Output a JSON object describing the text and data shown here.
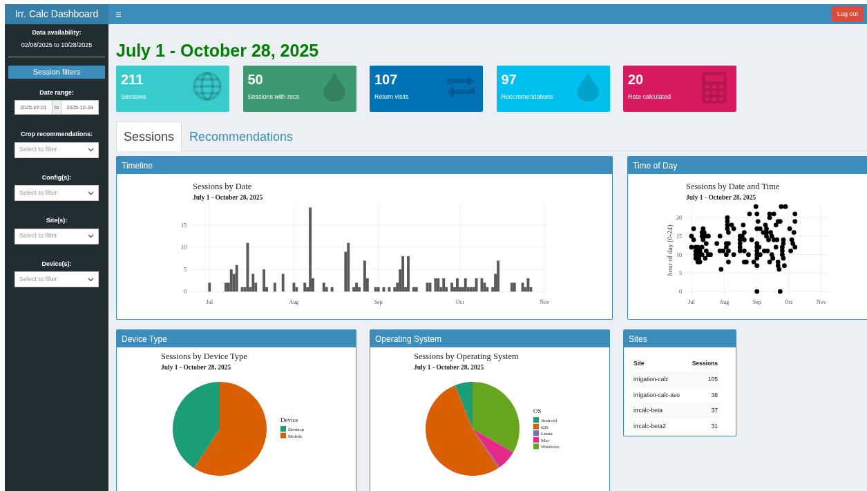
{
  "header": {
    "title": "Irr. Calc Dashboard",
    "menu_icon": "≡",
    "logout": "Log out"
  },
  "sidebar": {
    "availability_label": "Data availability:",
    "availability_range": "02/08/2025 to 10/28/2025",
    "filters_title": "Session filters",
    "date_range": {
      "label": "Date range:",
      "start": "2025-07-01",
      "separator": "to",
      "end": "2025-10-28"
    },
    "filters": [
      {
        "label": "Crop recommendations:",
        "placeholder": "Select to filter"
      },
      {
        "label": "Config(s):",
        "placeholder": "Select to filter"
      },
      {
        "label": "Site(s):",
        "placeholder": "Select to filter"
      },
      {
        "label": "Device(s):",
        "placeholder": "Select to filter"
      }
    ]
  },
  "page_title": "July 1 - October 28, 2025",
  "value_boxes": [
    {
      "value": "211",
      "label": "Sessions",
      "color": "#39cccc"
    },
    {
      "value": "50",
      "label": "Sessions with recs",
      "color": "#3d9970"
    },
    {
      "value": "107",
      "label": "Return visits",
      "color": "#0073b7"
    },
    {
      "value": "97",
      "label": "Recommendations",
      "color": "#00c0ef"
    },
    {
      "value": "20",
      "label": "Rate calculated",
      "color": "#d81b60"
    }
  ],
  "tabs": [
    {
      "label": "Sessions",
      "selected": true
    },
    {
      "label": "Recommendations",
      "selected": false
    }
  ],
  "timeline": {
    "heading": "Timeline",
    "subtitle": "July 1 - October 28, 2025",
    "chart_data": {
      "type": "bar",
      "title": "Sessions by Date",
      "x": [
        "2025-07-01",
        "2025-07-07",
        "2025-07-08",
        "2025-07-09",
        "2025-07-10",
        "2025-07-11",
        "2025-07-13",
        "2025-07-14",
        "2025-07-15",
        "2025-07-16",
        "2025-07-17",
        "2025-07-18",
        "2025-07-21",
        "2025-07-22",
        "2025-07-25",
        "2025-07-28",
        "2025-08-01",
        "2025-08-02",
        "2025-08-05",
        "2025-08-06",
        "2025-08-07",
        "2025-08-08",
        "2025-08-12",
        "2025-08-13",
        "2025-08-15",
        "2025-08-20",
        "2025-08-21",
        "2025-08-23",
        "2025-08-24",
        "2025-08-25",
        "2025-08-27",
        "2025-08-28",
        "2025-08-31",
        "2025-09-01",
        "2025-09-03",
        "2025-09-05",
        "2025-09-07",
        "2025-09-08",
        "2025-09-09",
        "2025-09-10",
        "2025-09-11",
        "2025-09-12",
        "2025-09-14",
        "2025-09-15",
        "2025-09-19",
        "2025-09-20",
        "2025-09-22",
        "2025-09-23",
        "2025-09-24",
        "2025-09-25",
        "2025-09-26",
        "2025-09-28",
        "2025-09-29",
        "2025-09-30",
        "2025-10-01",
        "2025-10-02",
        "2025-10-03",
        "2025-10-04",
        "2025-10-05",
        "2025-10-06",
        "2025-10-07",
        "2025-10-09",
        "2025-10-10",
        "2025-10-11",
        "2025-10-13",
        "2025-10-14",
        "2025-10-15",
        "2025-10-20",
        "2025-10-21",
        "2025-10-24",
        "2025-10-25",
        "2025-10-26",
        "2025-10-27"
      ],
      "values": [
        2,
        2,
        2,
        5,
        4,
        6,
        1,
        1,
        11,
        1,
        4,
        2,
        5,
        1,
        2,
        4,
        2,
        1,
        2,
        1,
        19,
        3,
        2,
        1,
        1,
        9,
        11,
        1,
        2,
        1,
        7,
        3,
        1,
        1,
        1,
        1,
        1,
        2,
        5,
        8,
        1,
        8,
        1,
        1,
        2,
        2,
        3,
        3,
        1,
        3,
        1,
        2,
        1,
        3,
        1,
        1,
        3,
        1,
        1,
        1,
        3,
        3,
        2,
        1,
        1,
        4,
        7,
        2,
        2,
        2,
        1,
        3,
        1
      ],
      "grid": true,
      "xlim": [
        "2025-06-23T14:00:00Z",
        "2025-11-02T12:00:00Z"
      ],
      "ylim": [
        -0.9,
        20
      ],
      "xticks": [
        {
          "value": "2025-07-01",
          "label": "Jul"
        },
        {
          "value": "2025-08-01",
          "label": "Aug"
        },
        {
          "value": "2025-09-01",
          "label": "Sep"
        },
        {
          "value": "2025-10-01",
          "label": "Oct"
        },
        {
          "value": "2025-11-01",
          "label": "Nov"
        }
      ],
      "yticks": [
        0,
        5,
        10,
        15
      ]
    }
  },
  "time_of_day": {
    "heading": "Time of Day",
    "subtitle": "July 1 - October 28, 2025",
    "chart_data": {
      "type": "scatter",
      "title": "Sessions by Date and Time",
      "ylabel": "hour of day (0-24)",
      "x": [
        "2025-07-01",
        "2025-07-01",
        "2025-07-03",
        "2025-07-03",
        "2025-07-05",
        "2025-07-05",
        "2025-07-05",
        "2025-07-05",
        "2025-07-06",
        "2025-07-07",
        "2025-07-07",
        "2025-07-07",
        "2025-07-08",
        "2025-07-09",
        "2025-07-09",
        "2025-07-09",
        "2025-07-11",
        "2025-07-11",
        "2025-07-11",
        "2025-07-11",
        "2025-07-12",
        "2025-07-12",
        "2025-07-13",
        "2025-07-13",
        "2025-07-14",
        "2025-07-15",
        "2025-07-15",
        "2025-07-15",
        "2025-07-17",
        "2025-07-17",
        "2025-07-19",
        "2025-07-25",
        "2025-07-28",
        "2025-07-28",
        "2025-07-29",
        "2025-07-31",
        "2025-08-03",
        "2025-08-03",
        "2025-08-03",
        "2025-08-04",
        "2025-08-04",
        "2025-08-04",
        "2025-08-04",
        "2025-08-05",
        "2025-08-05",
        "2025-08-05",
        "2025-08-05",
        "2025-08-08",
        "2025-08-10",
        "2025-08-10",
        "2025-08-16",
        "2025-08-16",
        "2025-08-16",
        "2025-08-16",
        "2025-08-16",
        "2025-08-18",
        "2025-08-19",
        "2025-08-20",
        "2025-08-20",
        "2025-08-20",
        "2025-08-20",
        "2025-08-22",
        "2025-08-24",
        "2025-08-25",
        "2025-08-27",
        "2025-08-29",
        "2025-08-31",
        "2025-09-01",
        "2025-09-01",
        "2025-09-01",
        "2025-09-01",
        "2025-09-01",
        "2025-09-01",
        "2025-09-01",
        "2025-09-01",
        "2025-09-01",
        "2025-09-02",
        "2025-09-03",
        "2025-09-04",
        "2025-09-04",
        "2025-09-07",
        "2025-09-08",
        "2025-09-09",
        "2025-09-10",
        "2025-09-10",
        "2025-09-10",
        "2025-09-11",
        "2025-09-12",
        "2025-09-13",
        "2025-09-13",
        "2025-09-13",
        "2025-09-14",
        "2025-09-15",
        "2025-09-15",
        "2025-09-16",
        "2025-09-17",
        "2025-09-17",
        "2025-09-19",
        "2025-09-19",
        "2025-09-20",
        "2025-09-21",
        "2025-09-21",
        "2025-09-21",
        "2025-09-22",
        "2025-09-23",
        "2025-09-23",
        "2025-09-24",
        "2025-09-25",
        "2025-09-25",
        "2025-09-25",
        "2025-09-26",
        "2025-09-26",
        "2025-09-26",
        "2025-09-27",
        "2025-09-28",
        "2025-10-02",
        "2025-10-03",
        "2025-10-04",
        "2025-10-05",
        "2025-10-06",
        "2025-10-07",
        "2025-10-07",
        "2025-10-07"
      ],
      "series": [
        {
          "color": "#000000",
          "values": [
            15,
            12,
            17,
            14,
            12,
            11,
            10,
            9,
            11,
            12,
            10,
            8,
            9,
            11,
            10,
            8,
            16,
            15,
            12,
            10,
            17,
            14,
            16,
            15,
            9,
            15,
            13,
            11,
            15,
            10,
            10,
            13,
            15,
            11,
            6,
            11,
            13,
            12,
            10,
            20,
            19,
            18,
            17,
            16,
            13,
            11,
            8,
            18,
            17,
            10,
            15,
            14,
            13,
            12,
            11,
            15,
            18,
            16,
            14,
            11,
            8,
            8,
            10,
            21,
            14,
            8,
            23,
            21,
            17,
            13,
            12,
            11,
            10,
            9,
            7,
            0,
            19,
            12,
            17,
            10,
            16,
            11,
            18,
            17,
            16,
            15,
            11,
            14,
            21,
            20,
            8,
            16,
            15,
            10,
            9,
            21,
            14,
            18,
            12,
            14,
            19,
            8,
            7,
            6,
            19,
            0,
            23,
            12,
            11,
            10,
            14,
            13,
            9,
            7,
            23,
            17,
            11,
            14,
            13,
            16,
            21,
            19,
            12
          ]
        }
      ],
      "grid": true,
      "xlim": [
        "2025-06-24T12:00:00Z",
        "2025-11-07T14:00:00Z"
      ],
      "ylim": [
        -1.1,
        23.4
      ],
      "xticks": [
        {
          "value": "2025-07-01",
          "label": "Jul"
        },
        {
          "value": "2025-08-01",
          "label": "Aug"
        },
        {
          "value": "2025-09-01",
          "label": "Sep"
        },
        {
          "value": "2025-10-01",
          "label": "Oct"
        },
        {
          "value": "2025-11-01",
          "label": "Nov"
        }
      ],
      "yticks": [
        0,
        5,
        10,
        15,
        20
      ]
    }
  },
  "device_type": {
    "heading": "Device Type",
    "subtitle": "July 1 - October 28, 2025",
    "legend_title": "Device",
    "chart_data": {
      "type": "pie",
      "title": "Sessions by Device Type",
      "legend": "right",
      "categories": [
        "Desktop",
        "Mobile"
      ],
      "values": [
        40.8,
        59.2
      ],
      "colors": [
        "#1b9e77",
        "#d95f02"
      ]
    }
  },
  "operating_system": {
    "heading": "Operating System",
    "subtitle": "July 1 - October 28, 2025",
    "legend_title": "OS",
    "chart_data": {
      "type": "pie",
      "title": "Sessions by Operating System",
      "legend": "right",
      "categories": [
        "Android",
        "iOS",
        "Linux",
        "Mac",
        "Windows"
      ],
      "values": [
        6.1,
        53.2,
        0.5,
        6.9,
        33.3
      ],
      "colors": [
        "#1b9e77",
        "#d95f02",
        "#7570b3",
        "#e7298a",
        "#66a61e"
      ]
    }
  },
  "sites": {
    "heading": "Sites",
    "columns": [
      "Site",
      "Sessions"
    ],
    "rows": [
      [
        "irrigation-calc",
        "105"
      ],
      [
        "irrigation-calc-avo",
        "38"
      ],
      [
        "irrcalc-beta",
        "37"
      ],
      [
        "irrcalc-beta2",
        "31"
      ]
    ]
  }
}
